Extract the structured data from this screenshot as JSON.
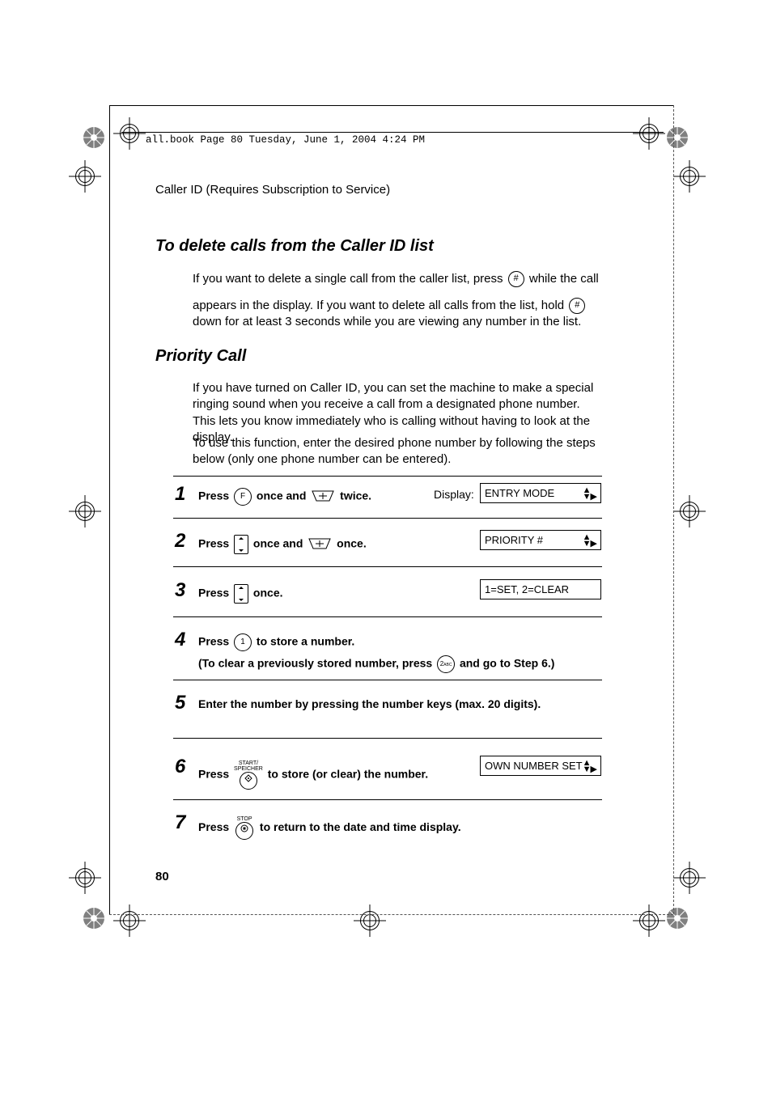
{
  "header": {
    "crop_text": "all.book  Page 80  Tuesday, June 1, 2004  4:24 PM",
    "running_head": "Caller ID (Requires Subscription to Service)"
  },
  "section1": {
    "title": "To delete calls from the Caller ID list",
    "para_a": "If you want to delete a single call from the caller list, press ",
    "key1": "#",
    "para_b": " while the call",
    "para_c": "appears in the display. If you want to delete all calls from the list, hold ",
    "key2": "#",
    "para_d": "down for at least 3 seconds while you are viewing any number in the list."
  },
  "section2": {
    "title": "Priority Call",
    "para1": "If you have turned on Caller ID, you can set the machine to make a special ringing sound when you receive a call from a designated phone number. This lets you know immediately who is calling without having to look at the display.",
    "para2": "To use this function, enter the desired phone number by following the steps below (only one phone number can be entered)."
  },
  "steps": {
    "display_label": "Display:",
    "s1": {
      "n": "1",
      "a": "Press ",
      "key1": "F",
      "b": " once and ",
      "c": " twice.",
      "lcd": "ENTRY MODE"
    },
    "s2": {
      "n": "2",
      "a": "Press ",
      "b": " once and ",
      "c": " once.",
      "lcd": "PRIORITY #"
    },
    "s3": {
      "n": "3",
      "a": "Press ",
      "b": " once.",
      "lcd": "1=SET, 2=CLEAR"
    },
    "s4": {
      "n": "4",
      "a": "Press ",
      "key1": "1",
      "b": " to store a number.",
      "sub_a": "(To clear a previously stored number, press ",
      "key2": "2",
      "sub_b": " and go to Step 6.)"
    },
    "s5": {
      "n": "5",
      "text": "Enter the number by pressing the number keys (max. 20 digits)."
    },
    "s6": {
      "n": "6",
      "a": "Press ",
      "lbl": "START/\nSPEICHER",
      "b": " to store (or clear) the number.",
      "lcd": "OWN NUMBER SET"
    },
    "s7": {
      "n": "7",
      "a": "Press ",
      "lbl": "STOP",
      "b": " to return to the date and time display."
    }
  },
  "page_number": "80"
}
